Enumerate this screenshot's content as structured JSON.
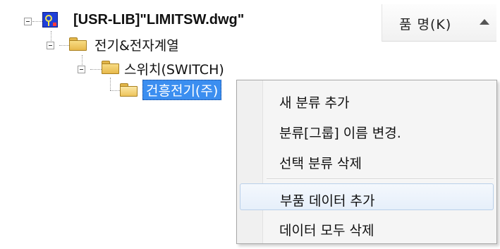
{
  "tree": {
    "root": {
      "label": "[USR-LIB]\"LIMITSW.dwg\"",
      "icon": "library-icon"
    },
    "level1": {
      "label": "전기&전자계열",
      "icon": "folder-icon"
    },
    "level2": {
      "label": "스위치(SWITCH)",
      "icon": "folder-icon"
    },
    "level3": {
      "label": "건흥전기(주)",
      "icon": "folder-open-icon",
      "selected": true
    }
  },
  "right_pane": {
    "column_header": "품  명(K)",
    "sort_icon": "sort-ascending-icon"
  },
  "context_menu": {
    "items": [
      {
        "label": "새 분류 추가"
      },
      {
        "label": "분류[그룹] 이름 변경."
      },
      {
        "label": "선택 분류 삭제"
      },
      {
        "label": "부품 데이터 추가",
        "highlighted": true
      },
      {
        "label": "데이터 모두 삭제"
      }
    ]
  },
  "colors": {
    "selection": "#3b8ef0",
    "menu_background": "#f5f5f5",
    "menu_hover": "#e6effa"
  }
}
